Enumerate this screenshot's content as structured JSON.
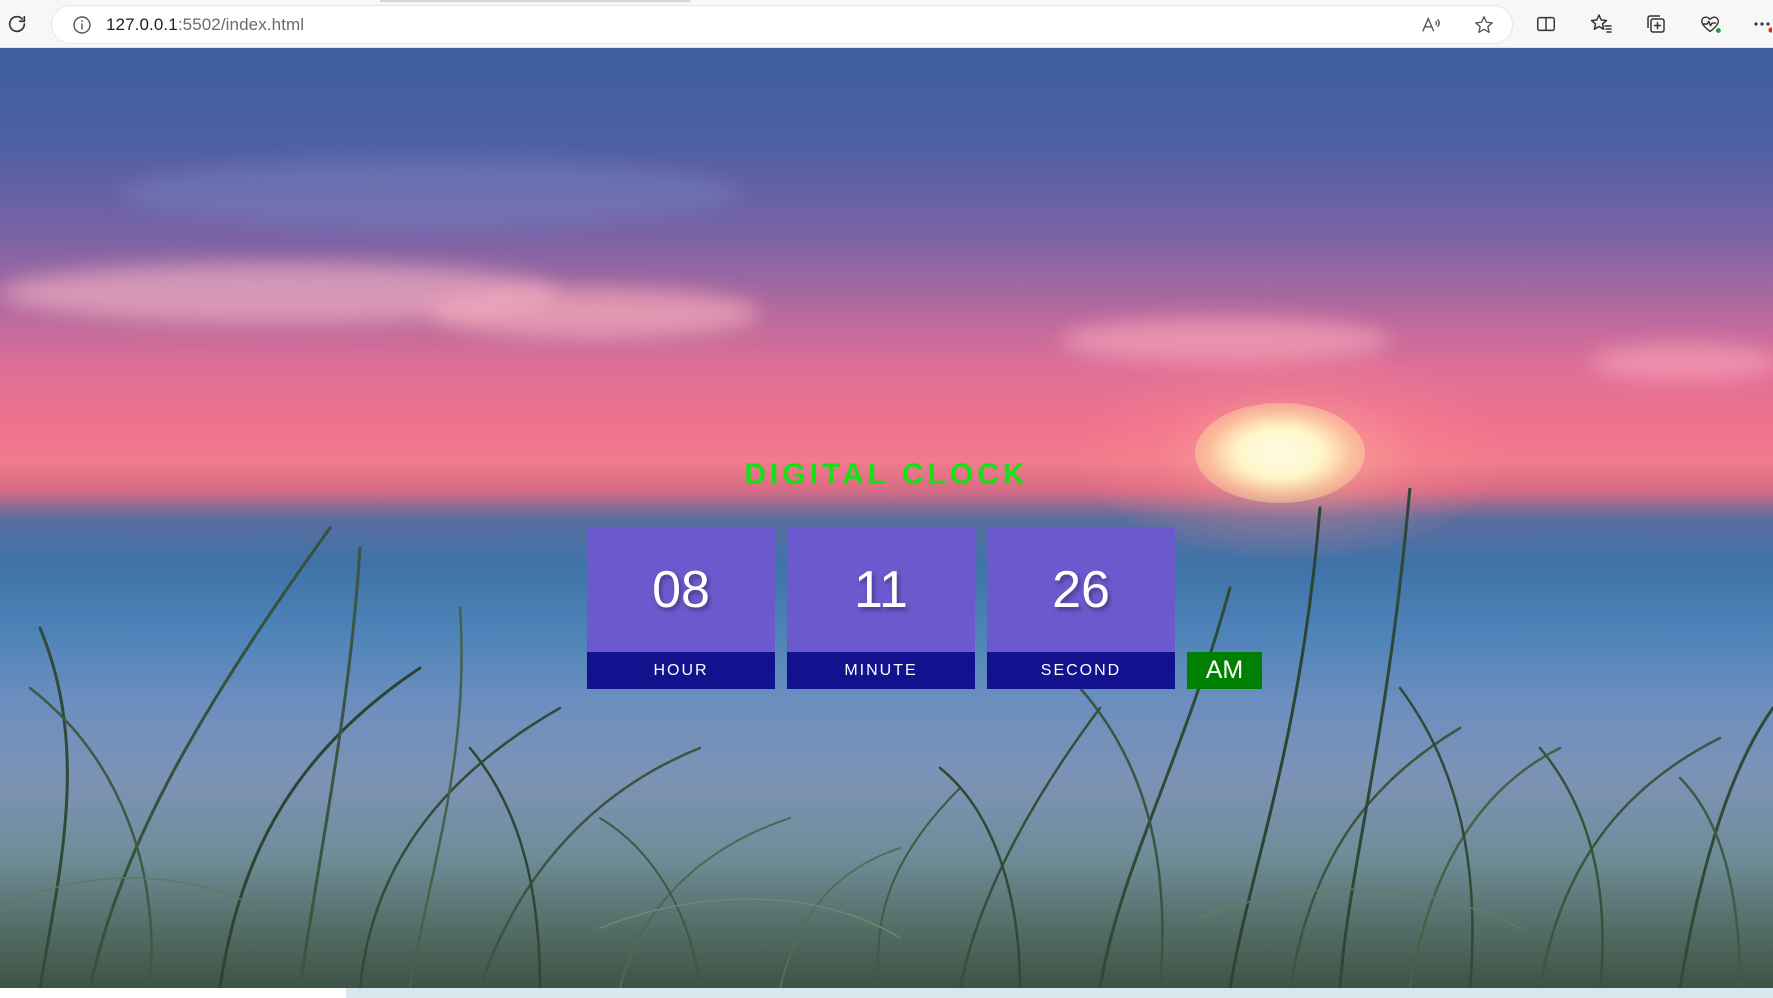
{
  "browser": {
    "url_host": "127.0.0.1",
    "url_rest": ":5502/index.html",
    "icons": {
      "reload": "reload-icon",
      "info": "info-icon",
      "read_aloud": "read-aloud-icon",
      "favorite": "star-icon",
      "split_screen": "split-screen-icon",
      "favorites": "favorites-icon",
      "collections": "collections-icon",
      "browser_essentials": "heart-pulse-icon",
      "more": "more-icon"
    }
  },
  "clock": {
    "title": "DIGITAL CLOCK",
    "hour": "08",
    "minute": "11",
    "second": "26",
    "hour_label": "HOUR",
    "minute_label": "MINUTE",
    "second_label": "SECOND",
    "period": "AM"
  },
  "colors": {
    "title": "#16e016",
    "value_bg": "#6a5acd",
    "label_bg": "#12128f",
    "period_bg": "#008000"
  }
}
